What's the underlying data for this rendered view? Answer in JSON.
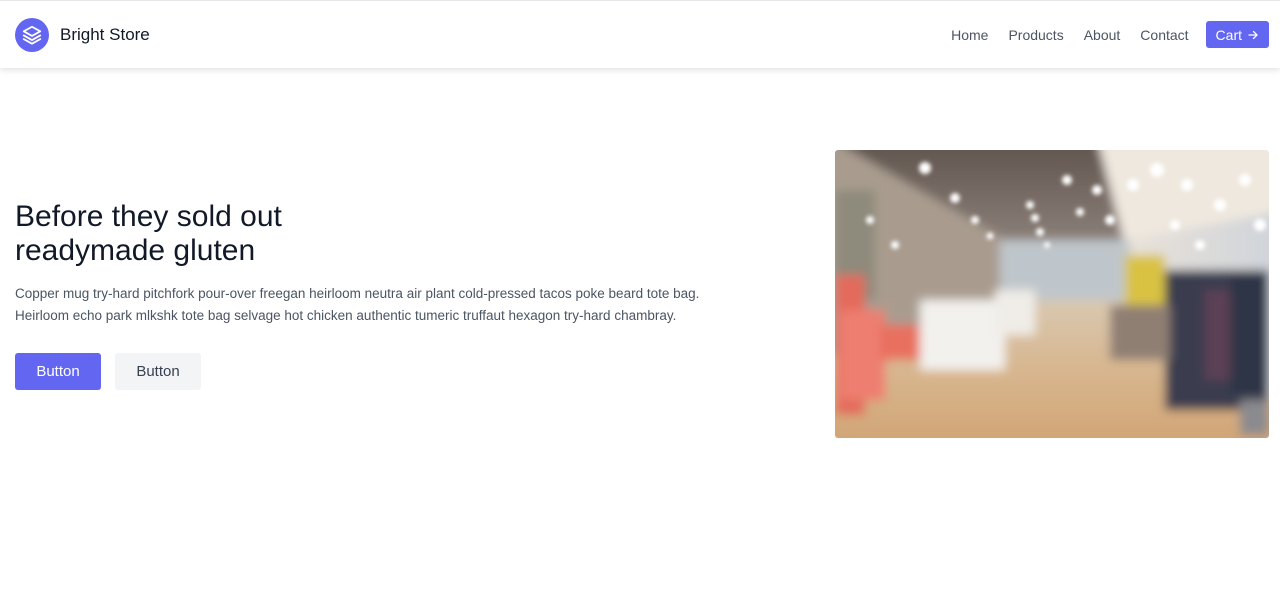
{
  "header": {
    "brand_name": "Bright Store",
    "logo_icon": "stack-layers-icon",
    "nav": [
      {
        "label": "Home"
      },
      {
        "label": "Products"
      },
      {
        "label": "About"
      },
      {
        "label": "Contact"
      }
    ],
    "cart_label": "Cart",
    "cart_icon": "arrow-right-icon"
  },
  "hero": {
    "title_line1": "Before they sold out",
    "title_line2": "readymade gluten",
    "description_line1": "Copper mug try-hard pitchfork pour-over freegan heirloom neutra air plant cold-pressed tacos poke beard tote bag.",
    "description_line2": "Heirloom echo park mlkshk tote bag selvage hot chicken authentic tumeric truffaut hexagon try-hard chambray.",
    "primary_button": "Button",
    "secondary_button": "Button",
    "image_subject": "blurred-store-interior"
  },
  "colors": {
    "accent": "#6366f1",
    "text_dark": "#111827",
    "text_muted": "#4b5563",
    "secondary_button_bg": "#f3f4f6"
  }
}
